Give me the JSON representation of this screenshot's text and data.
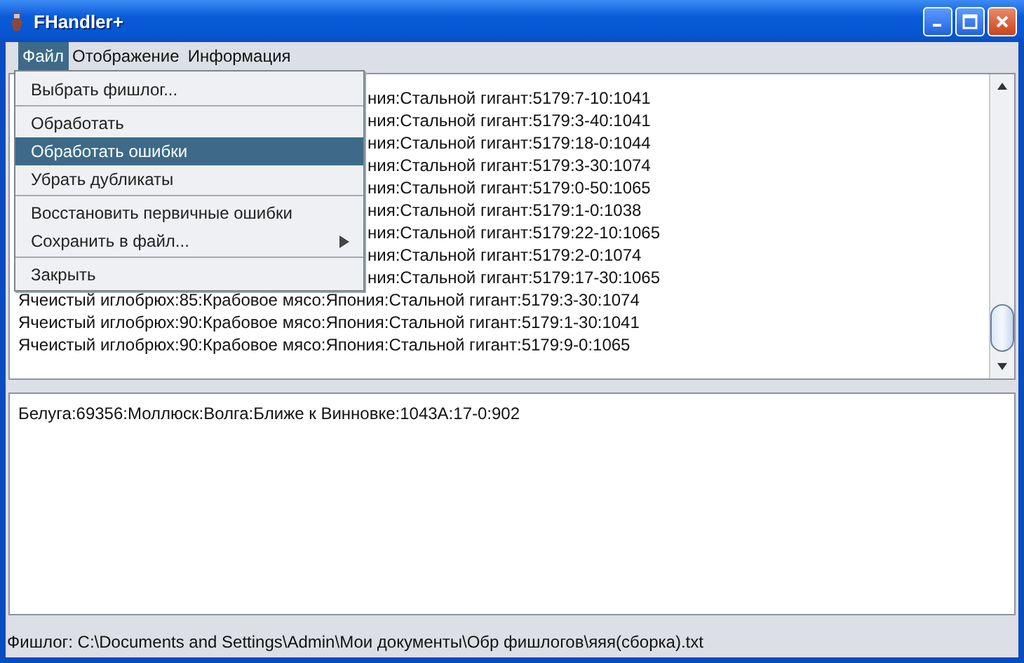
{
  "window": {
    "title": "FHandler+"
  },
  "menu_bar": [
    {
      "label": "Файл",
      "selected": true
    },
    {
      "label": "Отображение",
      "selected": false
    },
    {
      "label": "Информация",
      "selected": false
    }
  ],
  "open_menu": {
    "items": [
      {
        "kind": "item",
        "label": "Выбрать фишлог...",
        "selected": false
      },
      {
        "kind": "separator"
      },
      {
        "kind": "item",
        "label": "Обработать",
        "selected": false
      },
      {
        "kind": "item",
        "label": "Обработать ошибки",
        "selected": true
      },
      {
        "kind": "item",
        "label": "Убрать дубликаты",
        "selected": false
      },
      {
        "kind": "separator"
      },
      {
        "kind": "item",
        "label": "Восстановить первичные ошибки",
        "selected": false
      },
      {
        "kind": "submenu",
        "label": "Сохранить в файл...",
        "selected": false
      },
      {
        "kind": "separator"
      },
      {
        "kind": "item",
        "label": "Закрыть",
        "selected": false
      }
    ]
  },
  "upper_list": {
    "rows": [
      {
        "kind": "partial",
        "text": "ния:Стальной гигант:5179:7-10:1041"
      },
      {
        "kind": "partial",
        "text": "ния:Стальной гигант:5179:3-40:1041"
      },
      {
        "kind": "partial",
        "text": "ния:Стальной гигант:5179:18-0:1044"
      },
      {
        "kind": "partial",
        "text": "ния:Стальной гигант:5179:3-30:1074"
      },
      {
        "kind": "partial",
        "text": "ния:Стальной гигант:5179:0-50:1065"
      },
      {
        "kind": "partial",
        "text": "ния:Стальной гигант:5179:1-0:1038"
      },
      {
        "kind": "partial",
        "text": "ния:Стальной гигант:5179:22-10:1065"
      },
      {
        "kind": "partial",
        "text": "ния:Стальной гигант:5179:2-0:1074"
      },
      {
        "kind": "partial",
        "text": "ния:Стальной гигант:5179:17-30:1065"
      },
      {
        "kind": "full",
        "text": "Ячеистый иглобрюх:85:Крабовое мясо:Япония:Стальной гигант:5179:3-30:1074"
      },
      {
        "kind": "full",
        "text": "Ячеистый иглобрюх:90:Крабовое мясо:Япония:Стальной гигант:5179:1-30:1041"
      },
      {
        "kind": "full",
        "text": "Ячеистый иглобрюх:90:Крабовое мясо:Япония:Стальной гигант:5179:9-0:1065"
      }
    ]
  },
  "lower_list": {
    "rows": [
      "Белуга:69356:Моллюск:Волга:Ближе к Винновке:1043А:17-0:902"
    ]
  },
  "status_bar": "Фишлог: C:\\Documents and Settings\\Admin\\Мои документы\\Обр фишлогов\\яяя(сборка).txt"
}
